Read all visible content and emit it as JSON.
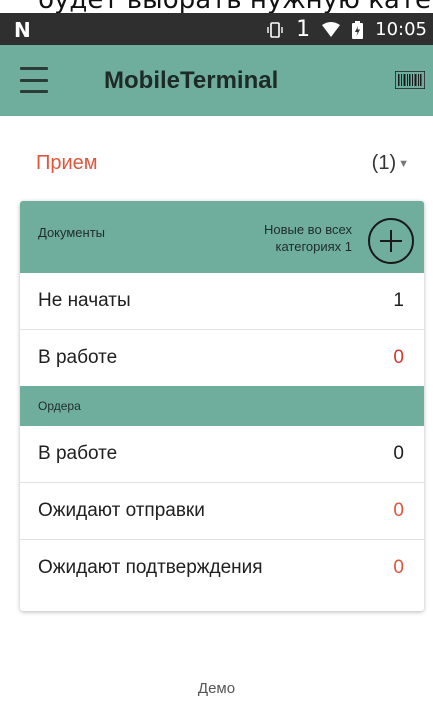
{
  "caption": "будет выбрать нужную кате",
  "status_bar": {
    "sim": "1",
    "time": "10:05"
  },
  "appbar": {
    "title": "MobileTerminal"
  },
  "section": {
    "title": "Прием",
    "count": "(1)"
  },
  "documents_group": {
    "label": "Документы",
    "new_line1": "Новые во всех",
    "new_line2": "категориях 1"
  },
  "documents_rows": [
    {
      "label": "Не начаты",
      "value": "1",
      "value_color": "#202020"
    },
    {
      "label": "В работе",
      "value": "0",
      "value_color": "#d6362a"
    }
  ],
  "orders_group": {
    "label": "Ордера"
  },
  "orders_rows": [
    {
      "label": "В работе",
      "value": "0",
      "value_color": "#202020"
    },
    {
      "label": "Ожидают отправки",
      "value": "0",
      "value_color": "#e0563b"
    },
    {
      "label": "Ожидают подтверждения",
      "value": "0",
      "value_color": "#e0563b"
    }
  ],
  "footer": "Демо",
  "colors": {
    "accent": "#6fae9d",
    "title_red": "#e0563b",
    "status_bar": "#2f2f2f"
  }
}
